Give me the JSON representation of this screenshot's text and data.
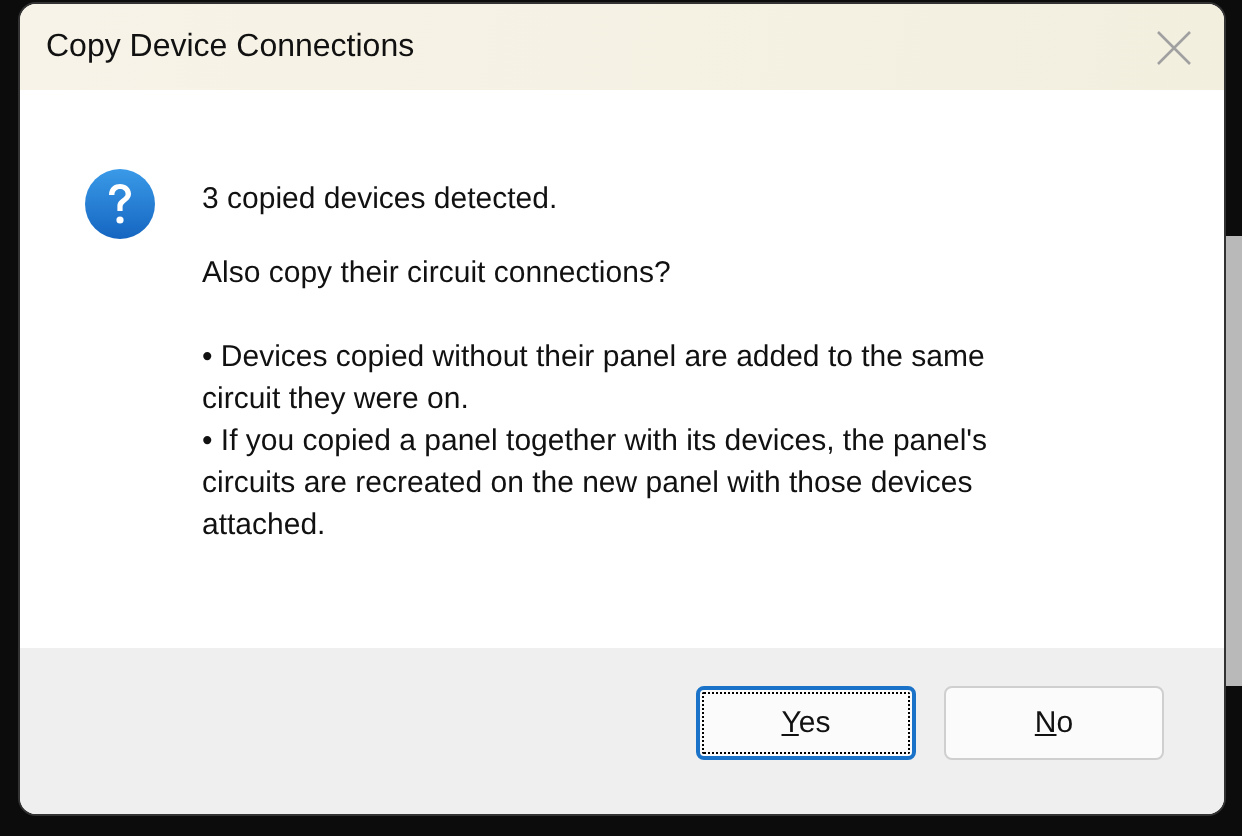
{
  "window": {
    "title": "Copy Device Connections"
  },
  "message": {
    "heading": "3 copied devices detected.",
    "question": "Also copy their circuit connections?",
    "bullets": [
      "• Devices copied without their panel are added to the same circuit they were on.",
      "• If you copied a panel together with its devices, the panel's circuits are recreated on the new panel with those devices attached."
    ]
  },
  "buttons": [
    {
      "label": "Yes",
      "underline_first": true,
      "focused": true
    },
    {
      "label": "No",
      "underline_first": true,
      "focused": false
    }
  ]
}
